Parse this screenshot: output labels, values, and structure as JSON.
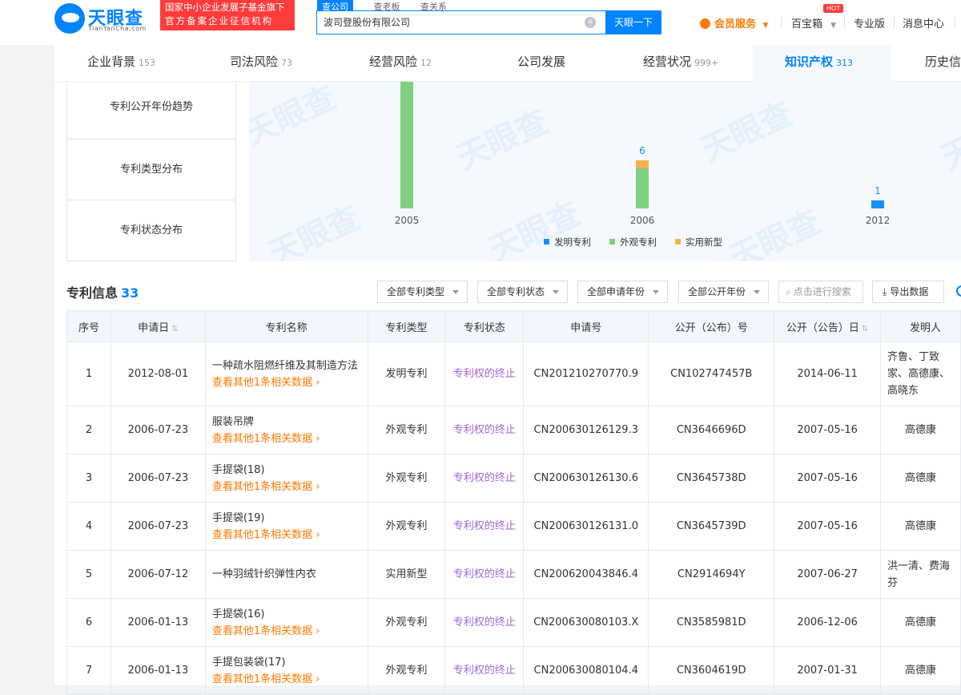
{
  "header": {
    "logo_text": "天眼查",
    "logo_sub": "TianYanCha.com",
    "gov_badge_line1": "国家中小企业发展子基金旗下",
    "gov_badge_line2": "官方备案企业征信机构",
    "search_tabs": [
      "查公司",
      "查老板",
      "查关系"
    ],
    "search_value": "波司登股份有限公司",
    "search_button": "天眼一下",
    "vip_label": "会员服务",
    "treasure_label": "百宝箱",
    "hot_badge": "HOT",
    "pro_label": "专业版",
    "message_label": "消息中心"
  },
  "tabs": [
    {
      "label": "企业背景",
      "count": "153"
    },
    {
      "label": "司法风险",
      "count": "73"
    },
    {
      "label": "经营风险",
      "count": "12"
    },
    {
      "label": "公司发展",
      "count": ""
    },
    {
      "label": "经营状况",
      "count": "999+"
    },
    {
      "label": "知识产权",
      "count": "313"
    },
    {
      "label": "历史信",
      "count": ""
    }
  ],
  "chart_menu": [
    "专利公开年份趋势",
    "专利类型分布",
    "专利状态分布"
  ],
  "chart_data": {
    "type": "bar",
    "stacked": true,
    "categories": [
      "2005",
      "2006",
      "2012"
    ],
    "series": [
      {
        "name": "发明专利",
        "color": "#1a8dff",
        "values": [
          0,
          0,
          1
        ]
      },
      {
        "name": "外观专利",
        "color": "#7fcf80",
        "values": [
          null,
          5,
          0
        ]
      },
      {
        "name": "实用新型",
        "color": "#f7b04e",
        "values": [
          0,
          1,
          0
        ]
      }
    ],
    "totals_labels": [
      "",
      "6",
      "1"
    ],
    "legend_position": "bottom-center"
  },
  "watermark": "天眼查",
  "patent_info": {
    "title": "专利信息",
    "count": "33",
    "filters": [
      "全部专利类型",
      "全部专利状态",
      "全部申请年份",
      "全部公开年份"
    ],
    "search_placeholder": "点击进行搜索",
    "export_label": "导出数据",
    "columns": [
      "序号",
      "申请日",
      "专利名称",
      "专利类型",
      "专利状态",
      "申请号",
      "公开（公布）号",
      "公开（公告）日",
      "发明人"
    ],
    "more_text": "查看其他1条相关数据",
    "rows": [
      {
        "no": "1",
        "date": "2012-08-01",
        "name": "一种疏水阻燃纤维及其制造方法",
        "more": true,
        "type": "发明专利",
        "status": "专利权的终止",
        "app_no": "CN201210270770.9",
        "pub_no": "CN102747457B",
        "pub_date": "2014-06-11",
        "inventor": "齐鲁、丁致家、高德康、高晓东"
      },
      {
        "no": "2",
        "date": "2006-07-23",
        "name": "服装吊牌",
        "more": true,
        "type": "外观专利",
        "status": "专利权的终止",
        "app_no": "CN200630126129.3",
        "pub_no": "CN3646696D",
        "pub_date": "2007-05-16",
        "inventor": "高德康"
      },
      {
        "no": "3",
        "date": "2006-07-23",
        "name": "手提袋(18)",
        "more": true,
        "type": "外观专利",
        "status": "专利权的终止",
        "app_no": "CN200630126130.6",
        "pub_no": "CN3645738D",
        "pub_date": "2007-05-16",
        "inventor": "高德康"
      },
      {
        "no": "4",
        "date": "2006-07-23",
        "name": "手提袋(19)",
        "more": true,
        "type": "外观专利",
        "status": "专利权的终止",
        "app_no": "CN200630126131.0",
        "pub_no": "CN3645739D",
        "pub_date": "2007-05-16",
        "inventor": "高德康"
      },
      {
        "no": "5",
        "date": "2006-07-12",
        "name": "一种羽绒针织弹性内衣",
        "more": false,
        "type": "实用新型",
        "status": "专利权的终止",
        "app_no": "CN200620043846.4",
        "pub_no": "CN2914694Y",
        "pub_date": "2007-06-27",
        "inventor": "洪一清、费海芬"
      },
      {
        "no": "6",
        "date": "2006-01-13",
        "name": "手提袋(16)",
        "more": true,
        "type": "外观专利",
        "status": "专利权的终止",
        "app_no": "CN200630080103.X",
        "pub_no": "CN3585981D",
        "pub_date": "2006-12-06",
        "inventor": "高德康"
      },
      {
        "no": "7",
        "date": "2006-01-13",
        "name": "手提包装袋(17)",
        "more": true,
        "type": "外观专利",
        "status": "专利权的终止",
        "app_no": "CN200630080104.4",
        "pub_no": "CN3604619D",
        "pub_date": "2007-01-31",
        "inventor": "高德康"
      }
    ]
  }
}
